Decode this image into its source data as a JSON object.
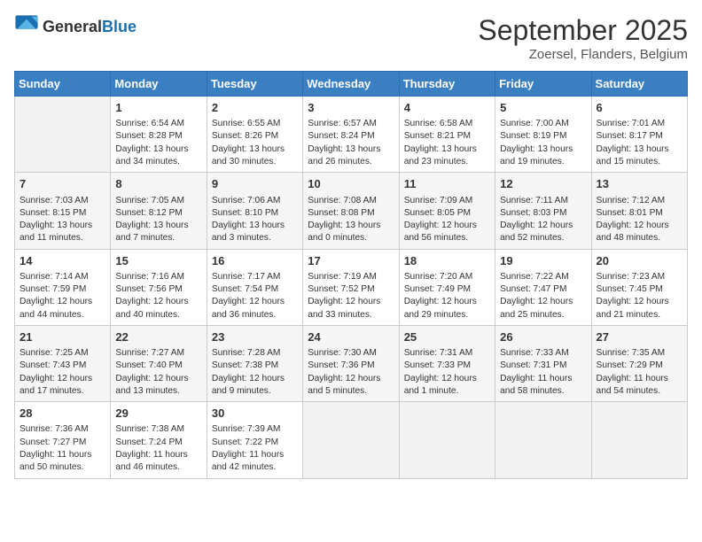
{
  "header": {
    "logo_general": "General",
    "logo_blue": "Blue",
    "title": "September 2025",
    "location": "Zoersel, Flanders, Belgium"
  },
  "days_of_week": [
    "Sunday",
    "Monday",
    "Tuesday",
    "Wednesday",
    "Thursday",
    "Friday",
    "Saturday"
  ],
  "weeks": [
    [
      {
        "day": "",
        "info": ""
      },
      {
        "day": "1",
        "info": "Sunrise: 6:54 AM\nSunset: 8:28 PM\nDaylight: 13 hours\nand 34 minutes."
      },
      {
        "day": "2",
        "info": "Sunrise: 6:55 AM\nSunset: 8:26 PM\nDaylight: 13 hours\nand 30 minutes."
      },
      {
        "day": "3",
        "info": "Sunrise: 6:57 AM\nSunset: 8:24 PM\nDaylight: 13 hours\nand 26 minutes."
      },
      {
        "day": "4",
        "info": "Sunrise: 6:58 AM\nSunset: 8:21 PM\nDaylight: 13 hours\nand 23 minutes."
      },
      {
        "day": "5",
        "info": "Sunrise: 7:00 AM\nSunset: 8:19 PM\nDaylight: 13 hours\nand 19 minutes."
      },
      {
        "day": "6",
        "info": "Sunrise: 7:01 AM\nSunset: 8:17 PM\nDaylight: 13 hours\nand 15 minutes."
      }
    ],
    [
      {
        "day": "7",
        "info": "Sunrise: 7:03 AM\nSunset: 8:15 PM\nDaylight: 13 hours\nand 11 minutes."
      },
      {
        "day": "8",
        "info": "Sunrise: 7:05 AM\nSunset: 8:12 PM\nDaylight: 13 hours\nand 7 minutes."
      },
      {
        "day": "9",
        "info": "Sunrise: 7:06 AM\nSunset: 8:10 PM\nDaylight: 13 hours\nand 3 minutes."
      },
      {
        "day": "10",
        "info": "Sunrise: 7:08 AM\nSunset: 8:08 PM\nDaylight: 13 hours\nand 0 minutes."
      },
      {
        "day": "11",
        "info": "Sunrise: 7:09 AM\nSunset: 8:05 PM\nDaylight: 12 hours\nand 56 minutes."
      },
      {
        "day": "12",
        "info": "Sunrise: 7:11 AM\nSunset: 8:03 PM\nDaylight: 12 hours\nand 52 minutes."
      },
      {
        "day": "13",
        "info": "Sunrise: 7:12 AM\nSunset: 8:01 PM\nDaylight: 12 hours\nand 48 minutes."
      }
    ],
    [
      {
        "day": "14",
        "info": "Sunrise: 7:14 AM\nSunset: 7:59 PM\nDaylight: 12 hours\nand 44 minutes."
      },
      {
        "day": "15",
        "info": "Sunrise: 7:16 AM\nSunset: 7:56 PM\nDaylight: 12 hours\nand 40 minutes."
      },
      {
        "day": "16",
        "info": "Sunrise: 7:17 AM\nSunset: 7:54 PM\nDaylight: 12 hours\nand 36 minutes."
      },
      {
        "day": "17",
        "info": "Sunrise: 7:19 AM\nSunset: 7:52 PM\nDaylight: 12 hours\nand 33 minutes."
      },
      {
        "day": "18",
        "info": "Sunrise: 7:20 AM\nSunset: 7:49 PM\nDaylight: 12 hours\nand 29 minutes."
      },
      {
        "day": "19",
        "info": "Sunrise: 7:22 AM\nSunset: 7:47 PM\nDaylight: 12 hours\nand 25 minutes."
      },
      {
        "day": "20",
        "info": "Sunrise: 7:23 AM\nSunset: 7:45 PM\nDaylight: 12 hours\nand 21 minutes."
      }
    ],
    [
      {
        "day": "21",
        "info": "Sunrise: 7:25 AM\nSunset: 7:43 PM\nDaylight: 12 hours\nand 17 minutes."
      },
      {
        "day": "22",
        "info": "Sunrise: 7:27 AM\nSunset: 7:40 PM\nDaylight: 12 hours\nand 13 minutes."
      },
      {
        "day": "23",
        "info": "Sunrise: 7:28 AM\nSunset: 7:38 PM\nDaylight: 12 hours\nand 9 minutes."
      },
      {
        "day": "24",
        "info": "Sunrise: 7:30 AM\nSunset: 7:36 PM\nDaylight: 12 hours\nand 5 minutes."
      },
      {
        "day": "25",
        "info": "Sunrise: 7:31 AM\nSunset: 7:33 PM\nDaylight: 12 hours\nand 1 minute."
      },
      {
        "day": "26",
        "info": "Sunrise: 7:33 AM\nSunset: 7:31 PM\nDaylight: 11 hours\nand 58 minutes."
      },
      {
        "day": "27",
        "info": "Sunrise: 7:35 AM\nSunset: 7:29 PM\nDaylight: 11 hours\nand 54 minutes."
      }
    ],
    [
      {
        "day": "28",
        "info": "Sunrise: 7:36 AM\nSunset: 7:27 PM\nDaylight: 11 hours\nand 50 minutes."
      },
      {
        "day": "29",
        "info": "Sunrise: 7:38 AM\nSunset: 7:24 PM\nDaylight: 11 hours\nand 46 minutes."
      },
      {
        "day": "30",
        "info": "Sunrise: 7:39 AM\nSunset: 7:22 PM\nDaylight: 11 hours\nand 42 minutes."
      },
      {
        "day": "",
        "info": ""
      },
      {
        "day": "",
        "info": ""
      },
      {
        "day": "",
        "info": ""
      },
      {
        "day": "",
        "info": ""
      }
    ]
  ]
}
